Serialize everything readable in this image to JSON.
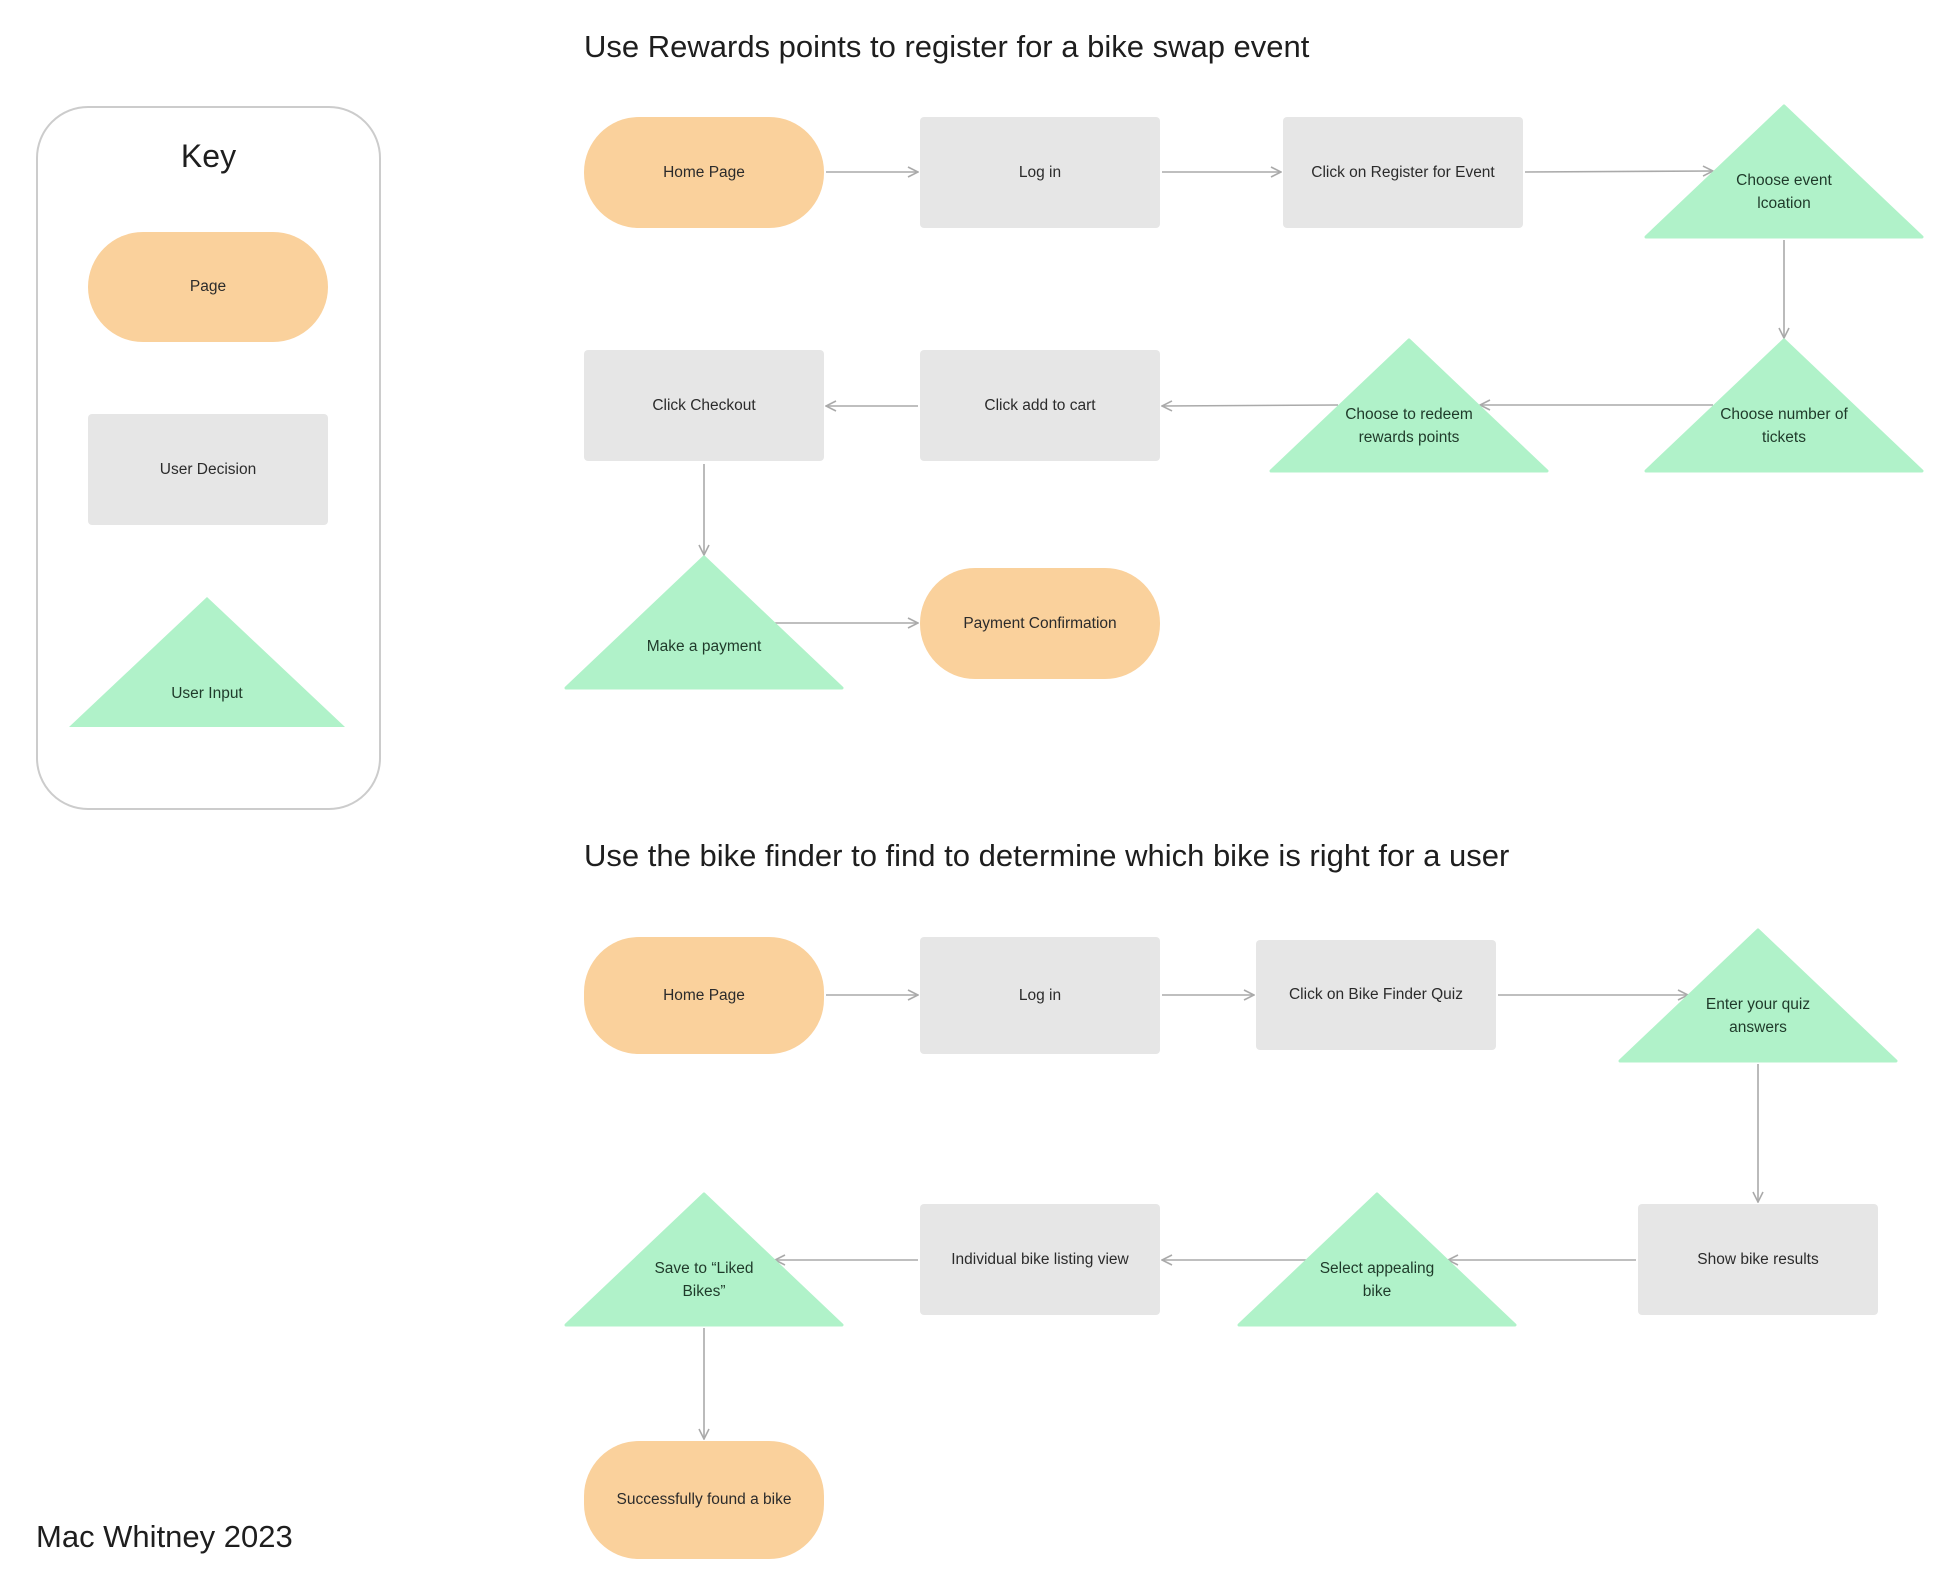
{
  "key": {
    "title": "Key",
    "items": [
      {
        "shape": "page",
        "label": "Page"
      },
      {
        "shape": "decision",
        "label": "User Decision"
      },
      {
        "shape": "input",
        "label": "User Input"
      }
    ]
  },
  "colors": {
    "page": "#fad19c",
    "decision": "#e6e6e6",
    "input": "#b0f2c9",
    "edge": "#aaaaaa",
    "key_border": "#cccccc"
  },
  "flows": [
    {
      "title": "Use Rewards points to register for a bike swap event",
      "nodes": [
        {
          "id": "f1-home",
          "shape": "page",
          "label": "Home Page"
        },
        {
          "id": "f1-login",
          "shape": "decision",
          "label": "Log in"
        },
        {
          "id": "f1-register",
          "shape": "decision",
          "label": "Click on Register for Event"
        },
        {
          "id": "f1-location",
          "shape": "input",
          "label": "Choose event\nlcoation"
        },
        {
          "id": "f1-tickets",
          "shape": "input",
          "label": "Choose number of\ntickets"
        },
        {
          "id": "f1-redeem",
          "shape": "input",
          "label": "Choose to redeem\nrewards points"
        },
        {
          "id": "f1-addcart",
          "shape": "decision",
          "label": "Click add to cart"
        },
        {
          "id": "f1-checkout",
          "shape": "decision",
          "label": "Click Checkout"
        },
        {
          "id": "f1-payment",
          "shape": "input",
          "label": "Make a payment"
        },
        {
          "id": "f1-confirm",
          "shape": "page",
          "label": "Payment Confirmation"
        }
      ],
      "edges": [
        [
          "f1-home",
          "f1-login"
        ],
        [
          "f1-login",
          "f1-register"
        ],
        [
          "f1-register",
          "f1-location"
        ],
        [
          "f1-location",
          "f1-tickets"
        ],
        [
          "f1-tickets",
          "f1-redeem"
        ],
        [
          "f1-redeem",
          "f1-addcart"
        ],
        [
          "f1-addcart",
          "f1-checkout"
        ],
        [
          "f1-checkout",
          "f1-payment"
        ],
        [
          "f1-payment",
          "f1-confirm"
        ]
      ]
    },
    {
      "title": "Use the bike finder to find to determine which bike is right for a user",
      "nodes": [
        {
          "id": "f2-home",
          "shape": "page",
          "label": "Home Page"
        },
        {
          "id": "f2-login",
          "shape": "decision",
          "label": "Log in"
        },
        {
          "id": "f2-quiz",
          "shape": "decision",
          "label": "Click on Bike Finder Quiz"
        },
        {
          "id": "f2-answers",
          "shape": "input",
          "label": "Enter your quiz\nanswers"
        },
        {
          "id": "f2-results",
          "shape": "decision",
          "label": "Show bike results"
        },
        {
          "id": "f2-select",
          "shape": "input",
          "label": "Select appealing\nbike"
        },
        {
          "id": "f2-listing",
          "shape": "decision",
          "label": "Individual bike listing view"
        },
        {
          "id": "f2-save",
          "shape": "input",
          "label": "Save to “Liked\nBikes”"
        },
        {
          "id": "f2-found",
          "shape": "page",
          "label": "Successfully found a bike"
        }
      ],
      "edges": [
        [
          "f2-home",
          "f2-login"
        ],
        [
          "f2-login",
          "f2-quiz"
        ],
        [
          "f2-quiz",
          "f2-answers"
        ],
        [
          "f2-answers",
          "f2-results"
        ],
        [
          "f2-results",
          "f2-select"
        ],
        [
          "f2-select",
          "f2-listing"
        ],
        [
          "f2-listing",
          "f2-save"
        ],
        [
          "f2-save",
          "f2-found"
        ]
      ]
    }
  ],
  "author": "Mac Whitney 2023"
}
